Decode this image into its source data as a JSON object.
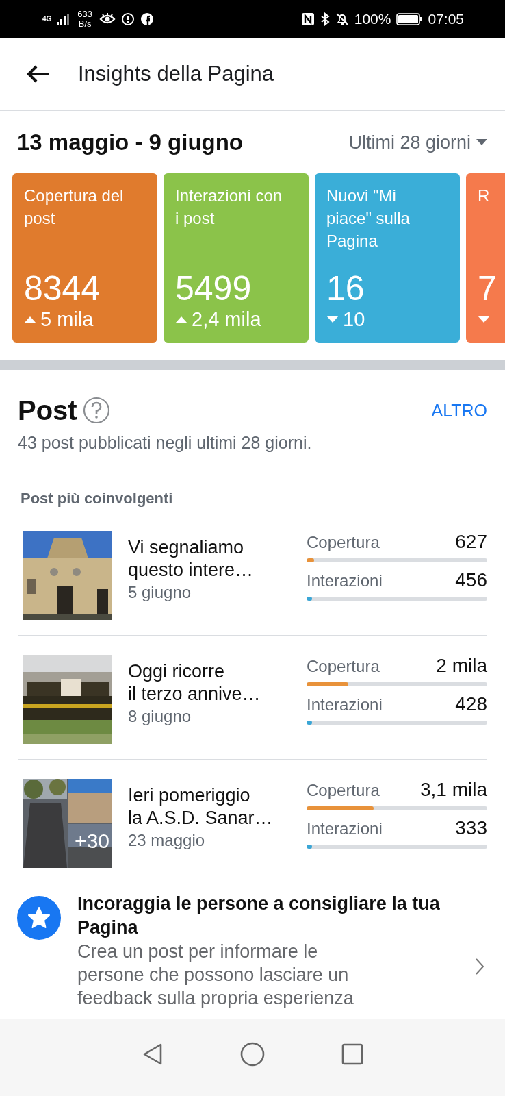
{
  "status_bar": {
    "network": "4G",
    "speed": "633",
    "speed_unit": "B/s",
    "battery": "100%",
    "time": "07:05"
  },
  "header": {
    "title": "Insights della Pagina"
  },
  "period": {
    "range": "13 maggio - 9 giugno",
    "selector": "Ultimi 28 giorni"
  },
  "cards": [
    {
      "label": "Copertura del post",
      "value": "8344",
      "change": "5 mila",
      "rising": true,
      "color": "#e07b2d"
    },
    {
      "label": "Interazioni con i post",
      "value": "5499",
      "change": "2,4 mila",
      "rising": true,
      "color": "#8bc34a"
    },
    {
      "label": "Nuovi \"Mi piace\" sulla Pagina",
      "value": "16",
      "change": "10",
      "rising": false,
      "color": "#3aaed8"
    },
    {
      "label": "R",
      "value": "7",
      "rising": false,
      "color": "#f57a4c"
    }
  ],
  "posts_section": {
    "title": "Post",
    "more": "ALTRO",
    "summary": "43 post pubblicati negli ultimi 28 giorni.",
    "subheading": "Post più coinvolgenti",
    "posts": [
      {
        "title": "Vi segnaliamo\nquesto intere…",
        "date": "5 giugno",
        "metrics": [
          {
            "kind": "reach",
            "label": "Copertura",
            "value": "627",
            "level": 0.04
          },
          {
            "kind": "engagement",
            "label": "Interazioni",
            "value": "456",
            "level": 0.03
          }
        ]
      },
      {
        "title": "Oggi ricorre\nil terzo annive…",
        "date": "8 giugno",
        "metrics": [
          {
            "kind": "reach",
            "label": "Copertura",
            "value": "2 mila",
            "level": 0.23
          },
          {
            "kind": "engagement",
            "label": "Interazioni",
            "value": "428",
            "level": 0.03
          }
        ]
      },
      {
        "title": "Ieri pomeriggio\nla A.S.D. Sanar…",
        "date": "23 maggio",
        "more_photos": "+30",
        "metrics": [
          {
            "kind": "reach",
            "label": "Copertura",
            "value": "3,1 mila",
            "level": 0.37
          },
          {
            "kind": "engagement",
            "label": "Interazioni",
            "value": "333",
            "level": 0.03
          }
        ]
      }
    ]
  },
  "promo": {
    "title": "Incoraggia le persone a consigliare la tua Pagina",
    "text": "Crea un post per informare le persone che possono lasciare un feedback sulla propria esperienza"
  }
}
